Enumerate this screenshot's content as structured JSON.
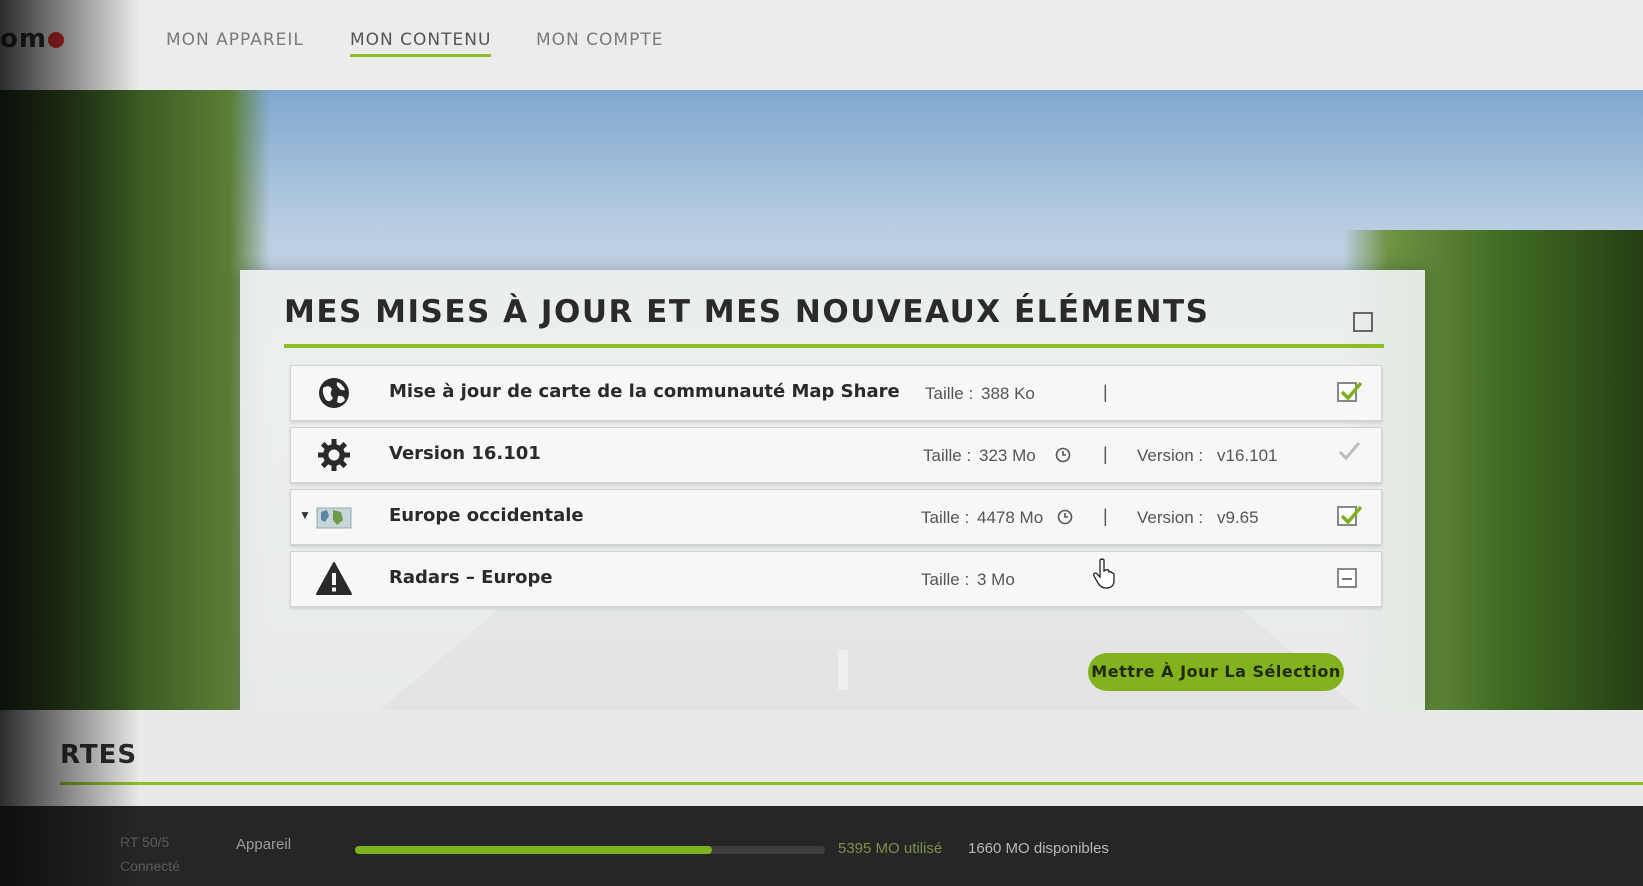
{
  "header": {
    "logo_text": "om",
    "nav": [
      {
        "label": "MON APPAREIL",
        "active": false
      },
      {
        "label": "MON CONTENU",
        "active": true
      },
      {
        "label": "MON COMPTE",
        "active": false
      }
    ]
  },
  "updates_panel": {
    "title": "MES MISES À JOUR ET MES NOUVEAUX ÉLÉMENTS",
    "items": [
      {
        "icon": "globe-icon",
        "title": "Mise à jour de carte de la communauté Map Share",
        "size_label": "Taille :",
        "size_value": "388 Ko",
        "separator": "|",
        "version_label": "",
        "version_value": "",
        "checked": true,
        "timer_icon": false
      },
      {
        "icon": "gear-icon",
        "title": "Version 16.101",
        "size_label": "Taille :",
        "size_value": "323 Mo",
        "separator": "|",
        "version_label": "Version :",
        "version_value": "v16.101",
        "checked": true,
        "disabled": true,
        "timer_icon": true
      },
      {
        "icon": "map-icon",
        "title": "Europe occidentale",
        "size_label": "Taille :",
        "size_value": "4478 Mo",
        "separator": "|",
        "version_label": "Version :",
        "version_value": "v9.65",
        "checked": true,
        "timer_icon": true,
        "expandable": true
      },
      {
        "icon": "warning-icon",
        "title": "Radars – Europe",
        "size_label": "Taille :",
        "size_value": "3 Mo",
        "separator": "|",
        "version_label": "",
        "version_value": "",
        "checked": "partial",
        "timer_icon": false
      }
    ],
    "update_button": "Mettre À Jour La Sélection"
  },
  "section2": {
    "title": "RTES"
  },
  "bottom_bar": {
    "device_model": "RT 50/5",
    "device_status": "Connecté",
    "device_label": "Appareil",
    "storage_used": "5395 MO utilisé",
    "storage_available": "1660 MO disponibles",
    "storage_fraction": 0.76
  },
  "colors": {
    "accent": "#8cbf26",
    "button": "#82b21e"
  }
}
